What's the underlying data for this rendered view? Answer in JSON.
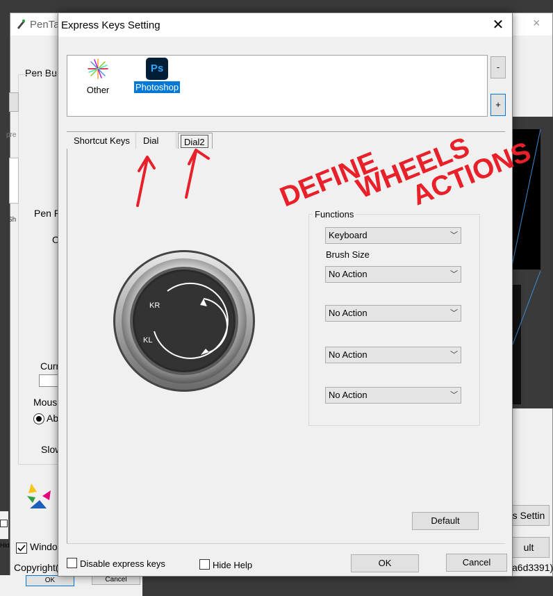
{
  "background_window": {
    "title": "PenTal",
    "close_icon": "×",
    "pen_buttons_label": "Pen Bu",
    "pen_pressure_label": "Pen P",
    "o_label": "O",
    "current_label": "Curr",
    "mouse_label": "Mous",
    "absolute_label": "Ab",
    "slow_label": "Slow",
    "windows_ink_label": "Windo",
    "copyright_label": "Copyright(",
    "hash_label": "a6d3391)",
    "settings_button_label": "s Settin",
    "default_button_label": "ult",
    "ok_button_label": "OK",
    "cancel_button_label": "Cancel",
    "hide_label": "Hid",
    "pre_label": "pre",
    "sh_label": "Sh",
    "d_label": "D"
  },
  "dialog": {
    "title": "Express Keys Setting",
    "close_icon": "✕",
    "apps": [
      {
        "label": "Other",
        "icon": "other-app-icon"
      },
      {
        "label": "Photoshop",
        "icon": "photoshop-icon",
        "icon_text": "Ps",
        "selected": true
      }
    ],
    "remove_label": "-",
    "add_label": "+",
    "tabs": [
      {
        "label": "Shortcut Keys"
      },
      {
        "label": "Dial"
      },
      {
        "label": "Dial2",
        "active": true
      }
    ],
    "dial": {
      "kr_label": "KR",
      "kl_label": "KL"
    },
    "functions_label": "Functions",
    "functions_value": "Keyboard",
    "brush_size_label": "Brush Size",
    "actions": [
      "No Action",
      "No Action",
      "No Action",
      "No Action"
    ],
    "default_label": "Default",
    "disable_express_keys_label": "Disable express keys",
    "hide_help_label": "Hide Help",
    "ok_label": "OK",
    "cancel_label": "Cancel"
  },
  "annotation": {
    "text_line1": "DEFINE",
    "text_line2": "WHEELS",
    "text_line3": "ACTIONS",
    "color": "#e8202a"
  },
  "colors": {
    "accent": "#0078d7",
    "photoshop_bg": "#001e36",
    "photoshop_fg": "#31a8ff"
  }
}
